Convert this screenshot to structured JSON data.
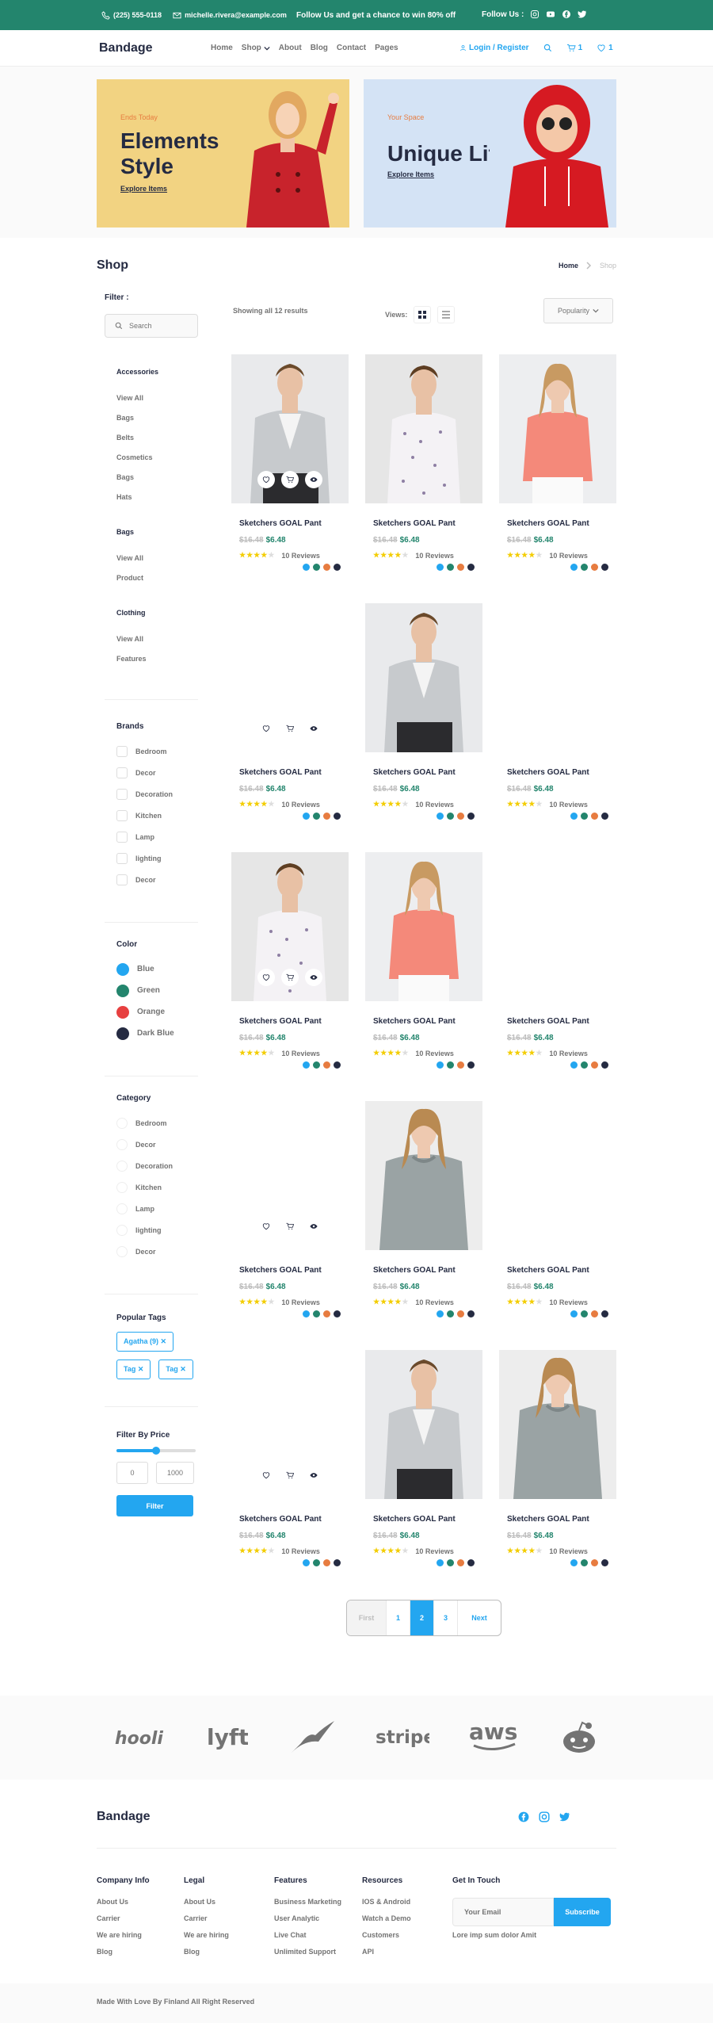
{
  "topbar": {
    "phone": "(225) 555-0118",
    "email": "michelle.rivera@example.com",
    "promo": "Follow Us  and get a chance to win 80% off",
    "follow": "Follow Us  :"
  },
  "nav": {
    "brand": "Bandage",
    "items": [
      "Home",
      "Shop",
      "About",
      "Blog",
      "Contact",
      "Pages"
    ],
    "login": "Login / Register",
    "cart_count": "1",
    "wish_count": "1"
  },
  "hero": [
    {
      "eyebrow": "Ends Today",
      "title": "Elements Style",
      "link": "Explore Items"
    },
    {
      "eyebrow": "Your Space",
      "title": "Unique Life",
      "link": "Explore Items"
    }
  ],
  "shop": {
    "title": "Shop",
    "breadcrumb": {
      "home": "Home",
      "current": "Shop"
    },
    "showing": "Showing all 12 results",
    "views": "Views:",
    "sort": "Popularity"
  },
  "sidebar": {
    "filter_label": "Filter :",
    "search_placeholder": "Search",
    "categories": [
      {
        "title": "Accessories",
        "items": [
          "View All",
          "Bags",
          "Belts",
          "Cosmetics",
          "Bags",
          "Hats"
        ]
      },
      {
        "title": "Bags",
        "items": [
          "View All",
          "Product"
        ]
      },
      {
        "title": "Clothing",
        "items": [
          "View All",
          "Features"
        ]
      }
    ],
    "brands_title": "Brands",
    "brands": [
      "Bedroom",
      "Decor",
      "Decoration",
      "Kitchen",
      "Lamp",
      "lighting",
      "Decor"
    ],
    "color_title": "Color",
    "colors": [
      {
        "name": "Blue",
        "hex": "#23A6F0"
      },
      {
        "name": "Green",
        "hex": "#23856D"
      },
      {
        "name": "Orange",
        "hex": "#E74040"
      },
      {
        "name": "Dark Blue",
        "hex": "#252B42"
      }
    ],
    "category_title": "Category",
    "category_items": [
      "Bedroom",
      "Decor",
      "Decoration",
      "Kitchen",
      "Lamp",
      "lighting",
      "Decor"
    ],
    "tags_title": "Popular Tags",
    "tags": [
      "Agatha (9)",
      "Tag",
      "Tag"
    ],
    "price_title": "Filter By Price",
    "price_level": 0.5,
    "price_min": "0",
    "price_max": "1000",
    "filter_button": "Filter"
  },
  "product": {
    "name": "Sketchers GOAL Pant",
    "old_price": "$16.48",
    "new_price": "$6.48",
    "reviews": "10 Reviews",
    "rating": 4,
    "swatches": [
      "#23A6F0",
      "#23856D",
      "#E77C40",
      "#252B42"
    ]
  },
  "product_images": [
    "jacket",
    "shirt",
    "pink",
    "none",
    "jacket",
    "none",
    "shirt",
    "pink",
    "none",
    "none",
    "grey",
    "none",
    "none",
    "jacket",
    "grey"
  ],
  "pagination": [
    "First",
    "1",
    "2",
    "3",
    "Next"
  ],
  "active_page": "2",
  "brands_logos": [
    "hooli",
    "lyft",
    "feather",
    "stripe",
    "aws",
    "reddit"
  ],
  "footer": {
    "brand": "Bandage",
    "columns": [
      {
        "title": "Company Info",
        "items": [
          "About Us",
          "Carrier",
          "We are hiring",
          "Blog"
        ]
      },
      {
        "title": "Legal",
        "items": [
          "About Us",
          "Carrier",
          "We are hiring",
          "Blog"
        ]
      },
      {
        "title": "Features",
        "items": [
          "Business Marketing",
          "User Analytic",
          "Live Chat",
          "Unlimited Support"
        ]
      },
      {
        "title": "Resources",
        "items": [
          "IOS & Android",
          "Watch a Demo",
          "Customers",
          "API"
        ]
      }
    ],
    "touch_title": "Get In Touch",
    "email_placeholder": "Your Email",
    "subscribe": "Subscribe",
    "note": "Lore imp sum dolor Amit",
    "copyright": "Made With Love By Finland All Right Reserved"
  }
}
